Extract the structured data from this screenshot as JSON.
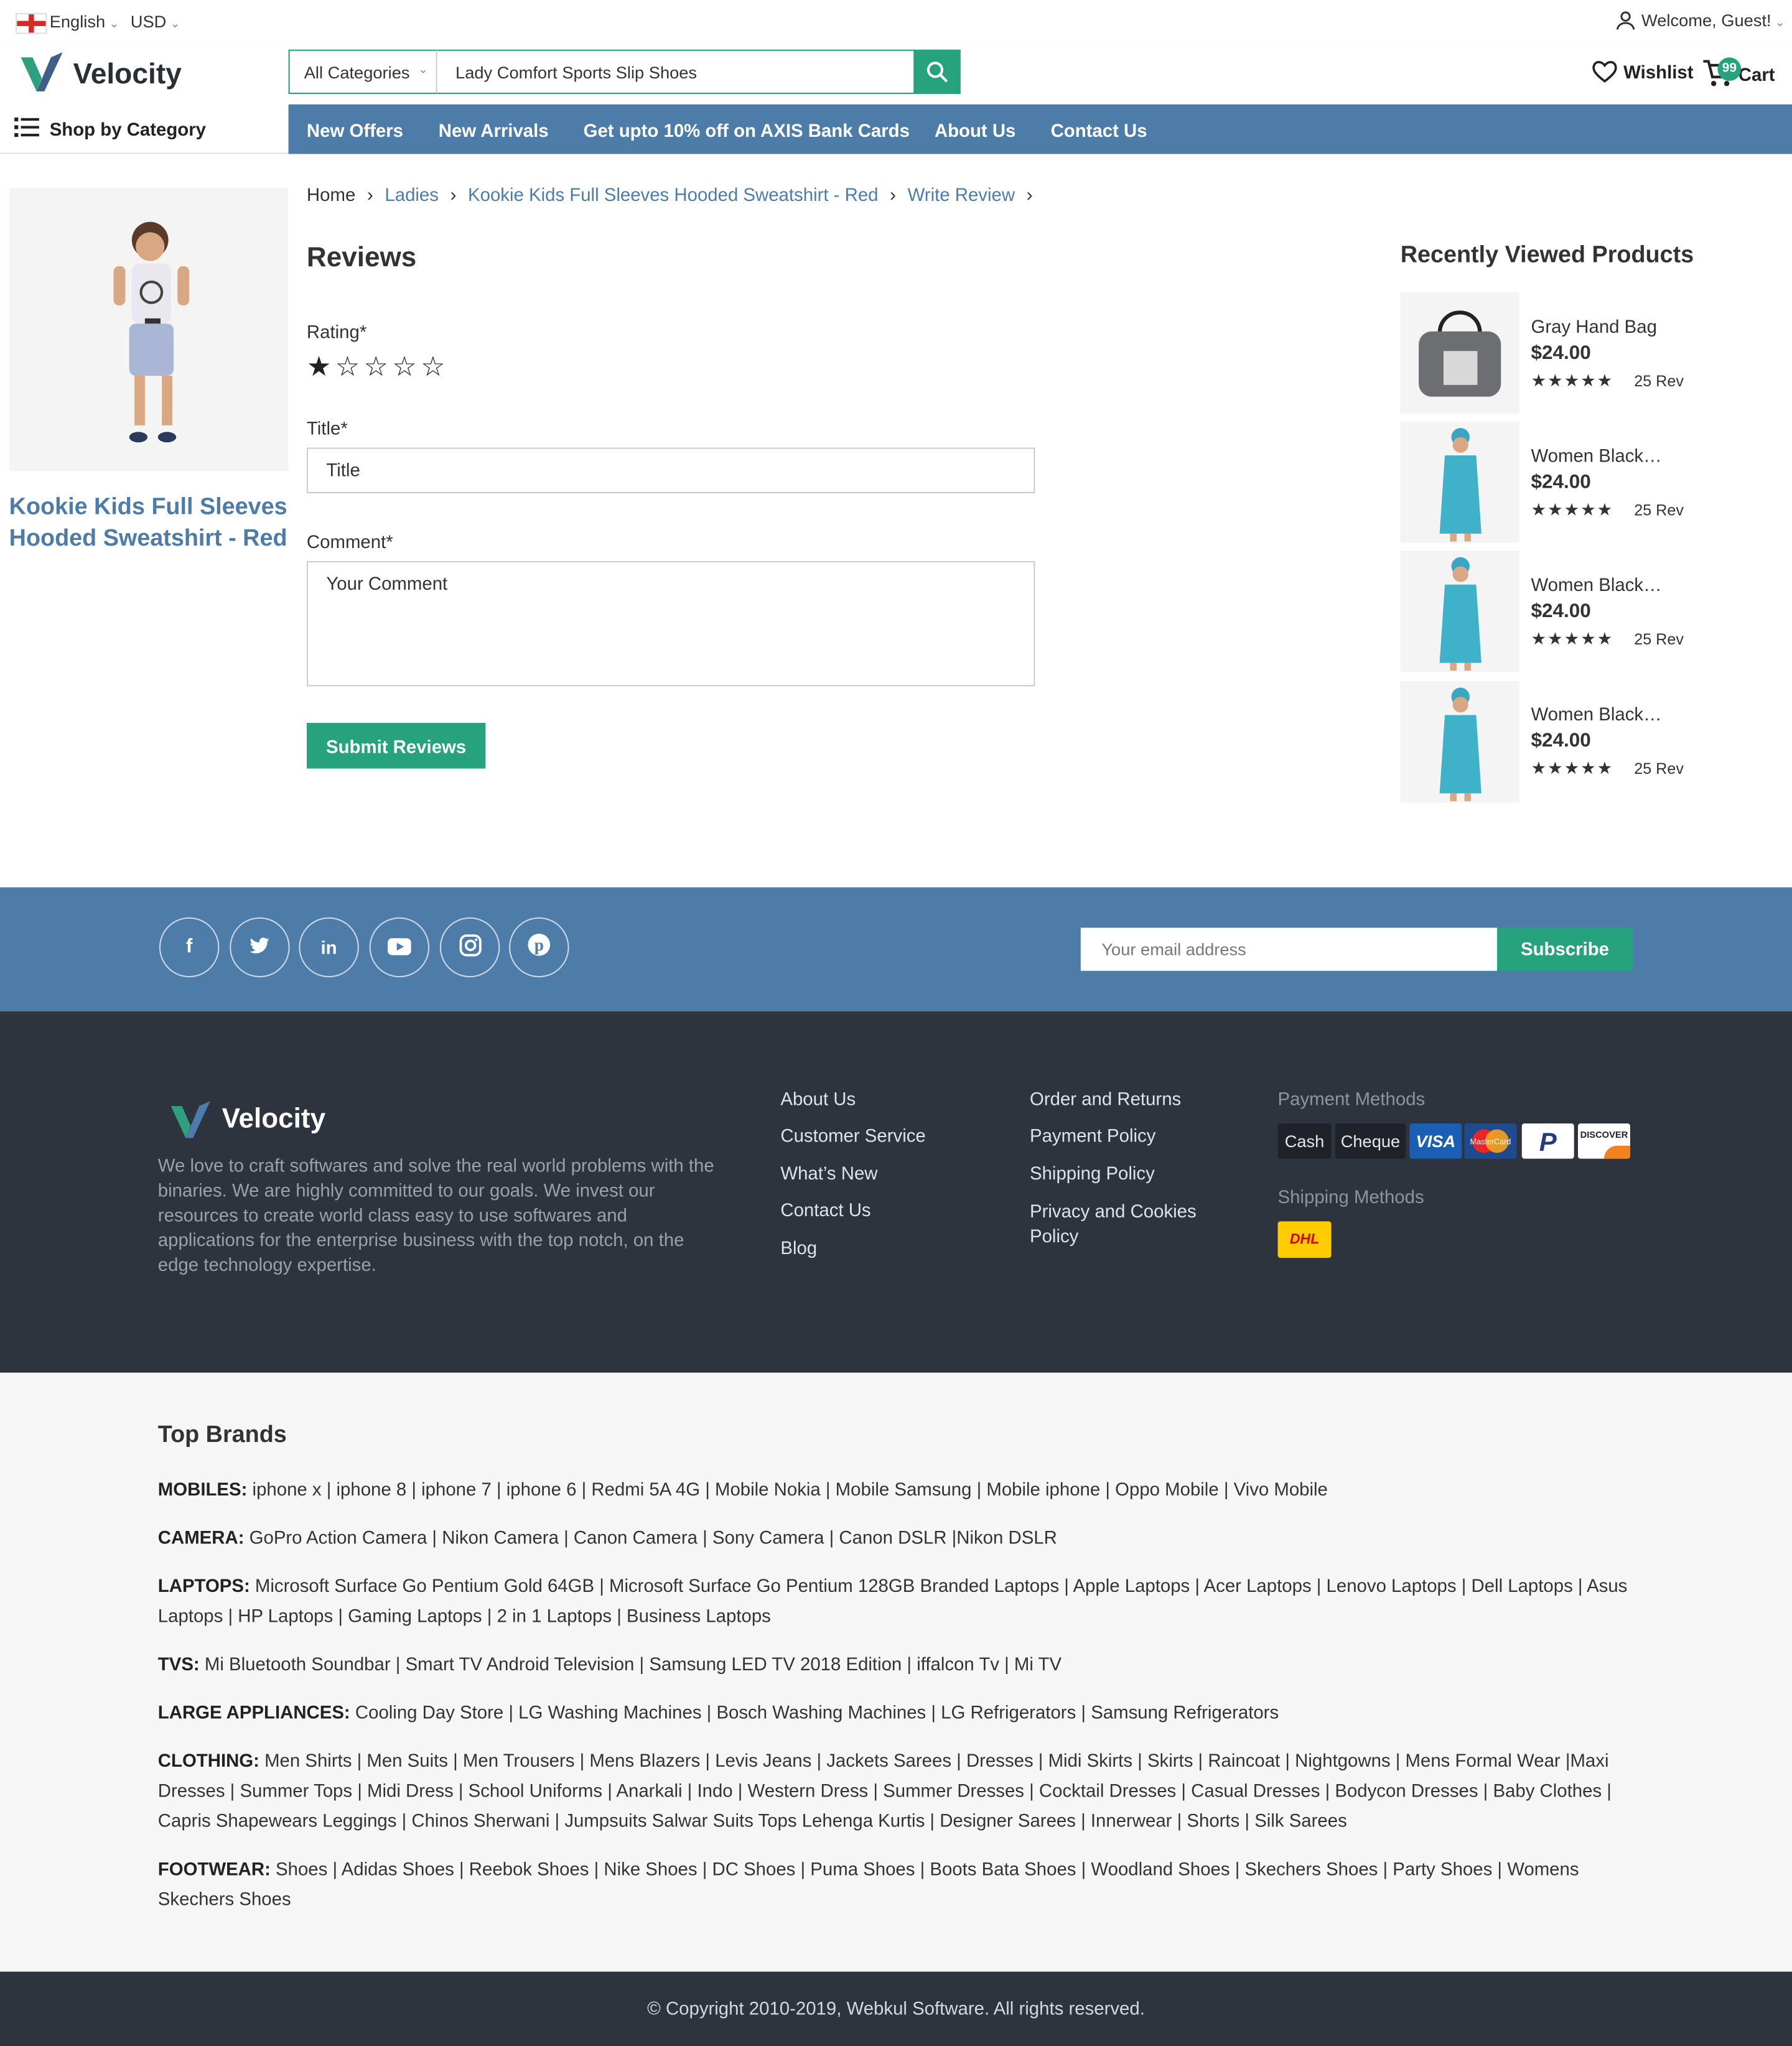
{
  "topbar": {
    "language": "English",
    "currency": "USD",
    "welcome": "Welcome, Guest!"
  },
  "header": {
    "brand": "Velocity",
    "search_category": "All Categories",
    "search_value": "Lady Comfort Sports Slip Shoes",
    "wishlist": "Wishlist",
    "cart": "Cart",
    "cart_count": "99"
  },
  "nav": {
    "shop_by_category": "Shop by Category",
    "items": [
      "New Offers",
      "New Arrivals",
      "Get upto 10% off on AXIS Bank Cards",
      "About Us",
      "Contact Us"
    ]
  },
  "product": {
    "name": "Kookie Kids Full Sleeves Hooded Sweatshirt - Red"
  },
  "breadcrumb": [
    "Home",
    "Ladies",
    "Kookie Kids Full Sleeves Hooded Sweatshirt - Red",
    "Write Review"
  ],
  "review_form": {
    "heading": "Reviews",
    "rating_label": "Rating*",
    "rating_value": 1,
    "rating_max": 5,
    "title_label": "Title*",
    "title_placeholder": "Title",
    "comment_label": "Comment*",
    "comment_placeholder": "Your Comment",
    "submit": "Submit Reviews"
  },
  "recently_viewed": {
    "heading": "Recently Viewed Products",
    "items": [
      {
        "name": "Gray Hand Bag",
        "price": "$24.00",
        "stars": "★★★★★",
        "reviews": "25 Rev"
      },
      {
        "name": "Women Black…",
        "price": "$24.00",
        "stars": "★★★★★",
        "reviews": "25 Rev"
      },
      {
        "name": "Women Black…",
        "price": "$24.00",
        "stars": "★★★★★",
        "reviews": "25 Rev"
      },
      {
        "name": "Women Black…",
        "price": "$24.00",
        "stars": "★★★★★",
        "reviews": "25 Rev"
      }
    ]
  },
  "social": {
    "icons": [
      "facebook-icon",
      "twitter-icon",
      "linkedin-icon",
      "youtube-icon",
      "instagram-icon",
      "pinterest-icon"
    ],
    "email_placeholder": "Your email address",
    "subscribe": "Subscribe"
  },
  "footer": {
    "brand": "Velocity",
    "description": "We love to craft softwares and solve the real world problems with the binaries. We are highly committed to our goals. We invest our resources to create world class easy to use softwares and applications for the enterprise business with the top notch, on the edge technology expertise.",
    "col1": [
      "About Us",
      "Customer Service",
      "What’s New",
      "Contact Us",
      "Blog"
    ],
    "col2": [
      "Order and Returns",
      "Payment Policy",
      "Shipping Policy",
      "Privacy and Cookies Policy"
    ],
    "payment_heading": "Payment Methods",
    "payments": [
      "Cash",
      "Cheque",
      "VISA",
      "MasterCard",
      "PayPal",
      "DISCOVER"
    ],
    "shipping_heading": "Shipping Methods",
    "shipping": "DHL"
  },
  "brands": {
    "heading": "Top Brands",
    "rows": [
      {
        "label": "MOBILES:",
        "text": "iphone x | iphone 8 | iphone 7 | iphone 6 | Redmi 5A 4G | Mobile Nokia | Mobile Samsung | Mobile iphone | Oppo Mobile | Vivo Mobile"
      },
      {
        "label": "CAMERA:",
        "text": "GoPro Action Camera | Nikon Camera | Canon Camera | Sony Camera | Canon DSLR |Nikon DSLR"
      },
      {
        "label": "LAPTOPS:",
        "text": "Microsoft Surface Go Pentium Gold 64GB | Microsoft Surface Go Pentium 128GB Branded Laptops | Apple Laptops | Acer Laptops | Lenovo Laptops | Dell Laptops | Asus Laptops | HP Laptops | Gaming Laptops | 2 in 1 Laptops | Business Laptops"
      },
      {
        "label": "TVS:",
        "text": "Mi Bluetooth Soundbar | Smart TV Android Television | Samsung LED TV 2018 Edition | iffalcon Tv | Mi TV"
      },
      {
        "label": "LARGE APPLIANCES:",
        "text": "Cooling Day Store | LG Washing Machines | Bosch Washing Machines | LG Refrigerators | Samsung Refrigerators"
      },
      {
        "label": "CLOTHING:",
        "text": "Men Shirts | Men Suits | Men Trousers | Mens Blazers | Levis Jeans | Jackets Sarees | Dresses | Midi Skirts | Skirts | Raincoat | Nightgowns | Mens Formal Wear |Maxi Dresses | Summer Tops | Midi Dress | School Uniforms | Anarkali | Indo | Western Dress | Summer Dresses | Cocktail Dresses | Casual Dresses | Bodycon Dresses | Baby Clothes | Capris Shapewears Leggings | Chinos Sherwani | Jumpsuits Salwar Suits Tops Lehenga Kurtis | Designer Sarees | Innerwear | Shorts | Silk Sarees"
      },
      {
        "label": "FOOTWEAR:",
        "text": "Shoes | Adidas Shoes | Reebok Shoes | Nike Shoes | DC Shoes | Puma Shoes | Boots Bata Shoes | Woodland Shoes | Skechers Shoes | Party Shoes | Womens Skechers Shoes"
      }
    ]
  },
  "copyright": "© Copyright 2010-2019, Webkul Software. All rights reserved.",
  "colors": {
    "accent": "#26a37c",
    "nav": "#4d7ca8",
    "footer": "#2e343d"
  }
}
